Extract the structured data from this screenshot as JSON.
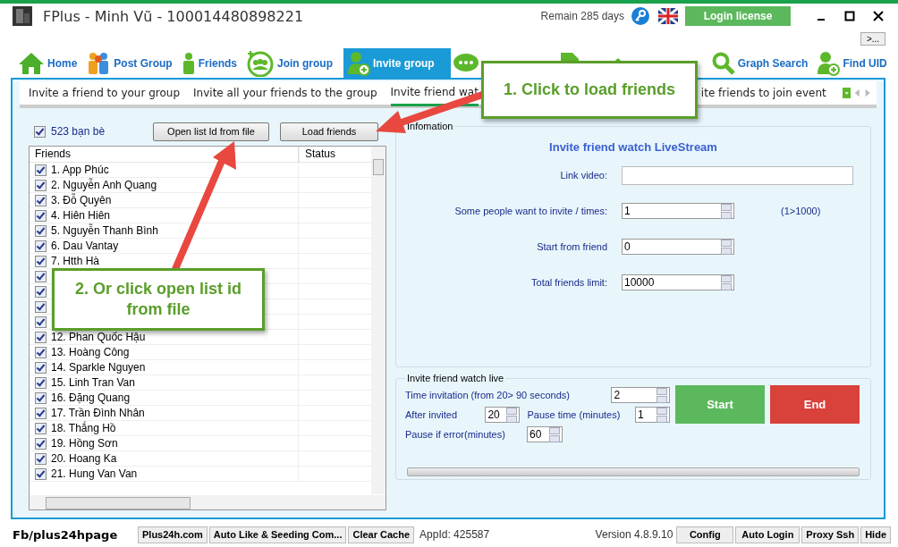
{
  "window": {
    "title": "FPlus - Minh Vũ - 100014480898221",
    "remaining": "Remain 285 days",
    "login_button": "Login license"
  },
  "more_button": ">...",
  "nav_tabs": [
    {
      "label": "Home",
      "kind": "home",
      "selected": false
    },
    {
      "label": "Post Group",
      "kind": "people",
      "selected": false
    },
    {
      "label": "Friends",
      "kind": "person",
      "selected": false
    },
    {
      "label": "Join group",
      "kind": "join",
      "selected": false
    },
    {
      "label": "Invite group",
      "kind": "invite",
      "selected": true
    },
    {
      "kind": "chat",
      "selected": false
    },
    {
      "kind": "doc",
      "selected": false
    },
    {
      "kind": "house",
      "selected": false
    },
    {
      "label": "Graph Search",
      "kind": "search",
      "selected": false
    },
    {
      "label": "Find UID",
      "kind": "invite",
      "selected": false
    }
  ],
  "sub_tabs": [
    {
      "label": "Invite a friend to your group",
      "selected": false
    },
    {
      "label": "Invite all your friends to the group",
      "selected": false
    },
    {
      "label": "Invite friend wat",
      "selected": true
    },
    {
      "label": "ite friends to join event",
      "selected": false
    }
  ],
  "select_all": {
    "checked": true,
    "label": "523 bạn bè"
  },
  "buttons": [
    "Open list Id from file",
    "Load friends"
  ],
  "friends_table": {
    "columns": [
      "Friends",
      "Status"
    ],
    "rows": [
      {
        "name": "1. App Phúc",
        "checked": true
      },
      {
        "name": "2. Nguyễn Anh Quang",
        "checked": true
      },
      {
        "name": "3. Đỗ Quyên",
        "checked": true
      },
      {
        "name": "4. Hiên Hiên",
        "checked": true
      },
      {
        "name": "5. Nguyễn Thanh Bình",
        "checked": true
      },
      {
        "name": "6. Dau Vantay",
        "checked": true
      },
      {
        "name": "7. Htth Hà",
        "checked": true
      },
      {
        "checked": true
      },
      {
        "checked": true
      },
      {
        "checked": true
      },
      {
        "checked": true
      },
      {
        "name": "12. Phan Quốc Hậu",
        "checked": true
      },
      {
        "name": "13. Hoàng Công",
        "checked": true
      },
      {
        "name": "14. Sparkle Nguyen",
        "checked": true
      },
      {
        "name": "15. Linh Tran Van",
        "checked": true
      },
      {
        "name": "16. Đặng Quang",
        "checked": true
      },
      {
        "name": "17. Trần Đình Nhân",
        "checked": true
      },
      {
        "name": "18. Thắng Hồ",
        "checked": true
      },
      {
        "name": "19. Hồng Sơn",
        "checked": true
      },
      {
        "name": "20. Hoang Ka",
        "checked": true
      },
      {
        "name": "21. Hung Van Van",
        "checked": true
      }
    ]
  },
  "information": {
    "title": "Infomation",
    "heading": "Invite friend watch LiveStream",
    "fields": [
      {
        "label": "Link video:",
        "kind": "text"
      },
      {
        "label": "Some people want to invite / times:",
        "kind": "spinner",
        "value": "1",
        "hint": "(1>1000)"
      },
      {
        "label": "Start from friend",
        "kind": "spinner",
        "value": "0"
      },
      {
        "label": "Total friends limit:",
        "kind": "spinner",
        "value": "10000"
      }
    ]
  },
  "live": {
    "title": "Invite friend watch live",
    "time_label": "Time invitation (from 20> 90 seconds)",
    "time_value": "2",
    "after_label": "After invited",
    "after_value": "20",
    "pause_label": "Pause time (minutes)",
    "pause_value": "1",
    "error_label": "Pause if error(minutes)",
    "error_value": "60",
    "start": "Start",
    "end": "End",
    "progress": {
      "level": 0
    }
  },
  "status_bar": {
    "page": "Fb/plus24hpage",
    "links": [
      "Plus24h.com",
      "Auto Like & Seeding Com...",
      "Clear Cache"
    ],
    "app_id": "AppId: 425587",
    "version": "Version 4.8.9.10",
    "buttons": [
      "Config",
      "Auto Login",
      "Proxy Ssh",
      "Hide"
    ]
  },
  "callouts": [
    {
      "text": "1. Click to load friends"
    },
    {
      "text": "2. Or click open list id from file"
    }
  ]
}
